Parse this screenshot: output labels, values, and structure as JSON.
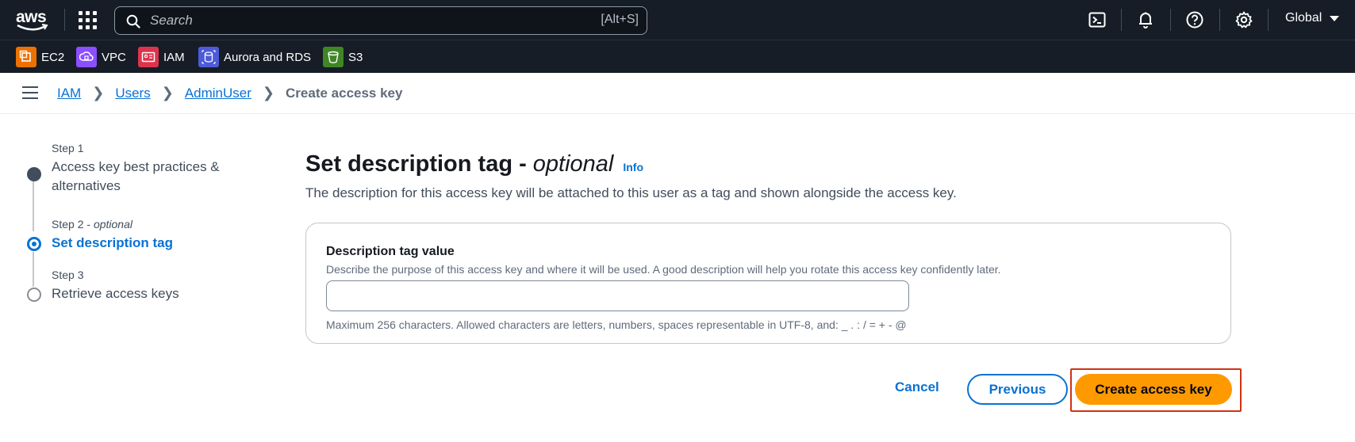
{
  "topbar": {
    "logo_text": "aws",
    "search_placeholder": "Search",
    "search_shortcut": "[Alt+S]",
    "region": "Global",
    "icons": [
      "apps-grid-icon",
      "cloudshell-icon",
      "notifications-bell-icon",
      "help-icon",
      "settings-gear-icon"
    ]
  },
  "favorites": [
    {
      "label": "EC2",
      "color": "#ed7100"
    },
    {
      "label": "VPC",
      "color": "#8c4fff"
    },
    {
      "label": "IAM",
      "color": "#dd344c"
    },
    {
      "label": "Aurora and RDS",
      "color": "#4d5bd9"
    },
    {
      "label": "S3",
      "color": "#3f8624"
    }
  ],
  "breadcrumb": {
    "items": [
      "IAM",
      "Users",
      "AdminUser"
    ],
    "current": "Create access key"
  },
  "steps": [
    {
      "number": "Step 1",
      "optional": "",
      "title": "Access key best practices & alternatives",
      "state": "done"
    },
    {
      "number": "Step 2",
      "optional": "optional",
      "title": "Set description tag",
      "state": "active"
    },
    {
      "number": "Step 3",
      "optional": "",
      "title": "Retrieve access keys",
      "state": "pending"
    }
  ],
  "page": {
    "title": "Set description tag -",
    "title_optional": "optional",
    "info": "Info",
    "description": "The description for this access key will be attached to this user as a tag and shown alongside the access key."
  },
  "form": {
    "label": "Description tag value",
    "description": "Describe the purpose of this access key and where it will be used. A good description will help you rotate this access key confidently later.",
    "value": "",
    "constraint": "Maximum 256 characters. Allowed characters are letters, numbers, spaces representable in UTF-8, and: _ . : / = + - @"
  },
  "actions": {
    "cancel": "Cancel",
    "previous": "Previous",
    "create": "Create access key"
  },
  "colors": {
    "nav_bg": "#161d26",
    "link": "#0972d3",
    "primary": "#ff9900",
    "highlight": "#d13212"
  }
}
